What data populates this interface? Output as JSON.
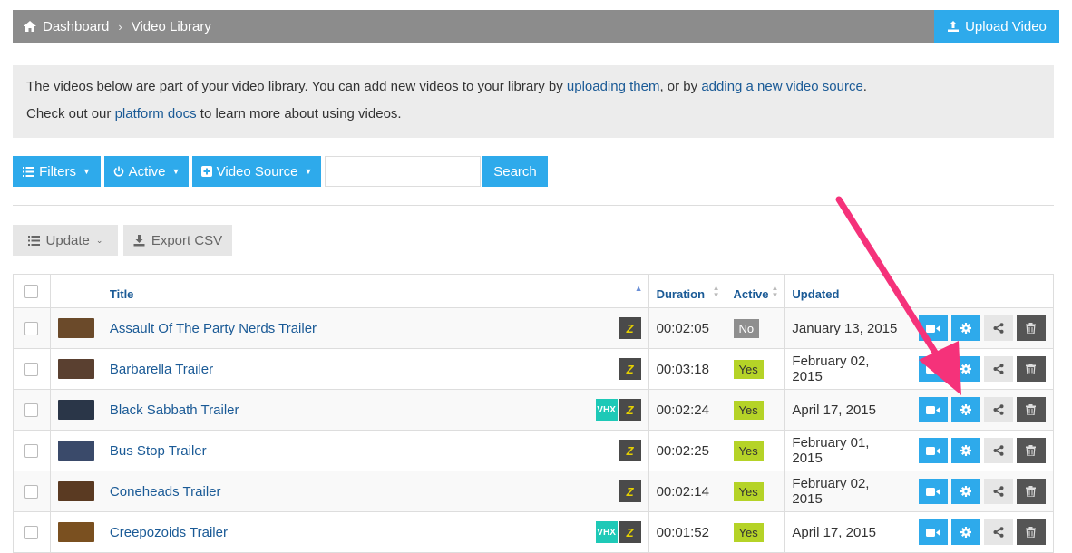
{
  "breadcrumb": {
    "home": "Dashboard",
    "current": "Video Library"
  },
  "upload_button": "Upload Video",
  "info": {
    "line1_before": "The videos below are part of your video library. You can add new videos to your library by ",
    "line1_link1": "uploading them",
    "line1_mid": ", or by ",
    "line1_link2": "adding a new video source",
    "line1_after": ".",
    "line2_before": "Check out our ",
    "line2_link": "platform docs",
    "line2_after": " to learn more about using videos."
  },
  "filters": {
    "filters_label": "Filters",
    "active_label": "Active",
    "source_label": "Video Source",
    "search_value": "",
    "search_button": "Search"
  },
  "actions": {
    "update_label": "Update",
    "export_label": "Export CSV"
  },
  "table": {
    "headers": {
      "title": "Title",
      "duration": "Duration",
      "active": "Active",
      "updated": "Updated"
    },
    "rows": [
      {
        "title": "Assault Of The Party Nerds Trailer",
        "vhx": false,
        "duration": "00:02:05",
        "active": "No",
        "updated": "January 13, 2015",
        "thumb": "#6b4a2a"
      },
      {
        "title": "Barbarella Trailer",
        "vhx": false,
        "duration": "00:03:18",
        "active": "Yes",
        "updated": "February 02, 2015",
        "thumb": "#5a4030"
      },
      {
        "title": "Black Sabbath Trailer",
        "vhx": true,
        "duration": "00:02:24",
        "active": "Yes",
        "updated": "April 17, 2015",
        "thumb": "#2a3648"
      },
      {
        "title": "Bus Stop Trailer",
        "vhx": false,
        "duration": "00:02:25",
        "active": "Yes",
        "updated": "February 01, 2015",
        "thumb": "#3a4a6a"
      },
      {
        "title": "Coneheads Trailer",
        "vhx": false,
        "duration": "00:02:14",
        "active": "Yes",
        "updated": "February 02, 2015",
        "thumb": "#5a3a22"
      },
      {
        "title": "Creepozoids Trailer",
        "vhx": true,
        "duration": "00:01:52",
        "active": "Yes",
        "updated": "April 17, 2015",
        "thumb": "#7a5020"
      }
    ]
  },
  "colors": {
    "accent": "#2eaaeb",
    "annotation_arrow": "#f5327a"
  }
}
